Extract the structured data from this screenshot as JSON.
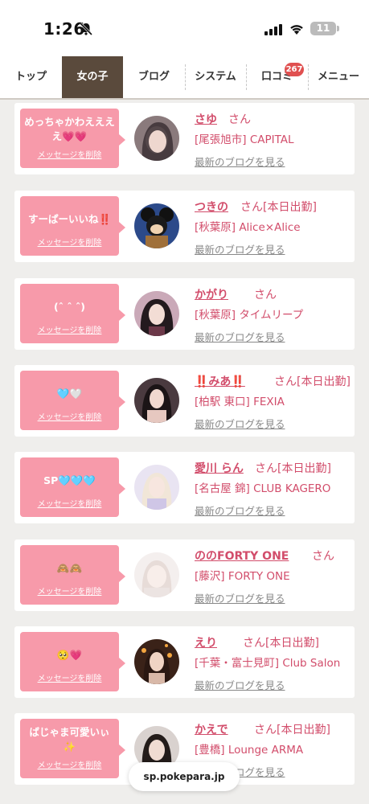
{
  "status_bar": {
    "time": "1:26",
    "battery": "11"
  },
  "tabs": [
    {
      "label": "トップ"
    },
    {
      "label": "女の子",
      "active": true
    },
    {
      "label": "ブログ"
    },
    {
      "label": "システム"
    },
    {
      "label": "口コミ",
      "badge": "267"
    },
    {
      "label": "メニュー"
    }
  ],
  "colors": {
    "accent": "#d24d6b",
    "message_bg": "#f79aaa",
    "active_tab": "#5a4a3c"
  },
  "delete_label": "メッセージを削除",
  "blog_label": "最新のブログを見る",
  "cards": [
    {
      "message": "めっちゃかわええええ💗💗",
      "name": "さゆ",
      "suffix": "さん",
      "shop": "[尾張旭市] CAPITAL"
    },
    {
      "message": "すーぱーいいね‼️",
      "name": "つきの",
      "suffix": "さん[本日出勤]",
      "shop": "[秋葉原] Alice×Alice"
    },
    {
      "message": "(ˆ ˆ ˆ)",
      "name": "かがり",
      "suffix": "さん",
      "shop": "[秋葉原] タイムリープ"
    },
    {
      "message": "🩵🤍",
      "name": "‼️みあ‼️",
      "suffix": "さん[本日出勤]",
      "shop": "[柏駅 東口] FEXIA"
    },
    {
      "message": "SP🩵🩵🩵",
      "name": "愛川 らん",
      "suffix": "さん[本日出勤]",
      "shop": "[名古屋 錦] CLUB KAGERO"
    },
    {
      "message": "🙈🙈",
      "name": "ののFORTY ONE",
      "suffix": "さん",
      "shop": "[藤沢] FORTY ONE"
    },
    {
      "message": "🥺💗",
      "name": "えり",
      "suffix": "さん[本日出勤]",
      "shop": "[千葉・富士見町] Club Salon"
    },
    {
      "message": "ばじゃま可愛いぃ✨",
      "name": "かえで",
      "suffix": "さん[本日出勤]",
      "shop": "[豊橋] Lounge ARMA"
    }
  ],
  "url_bar": "sp.pokepara.jp"
}
